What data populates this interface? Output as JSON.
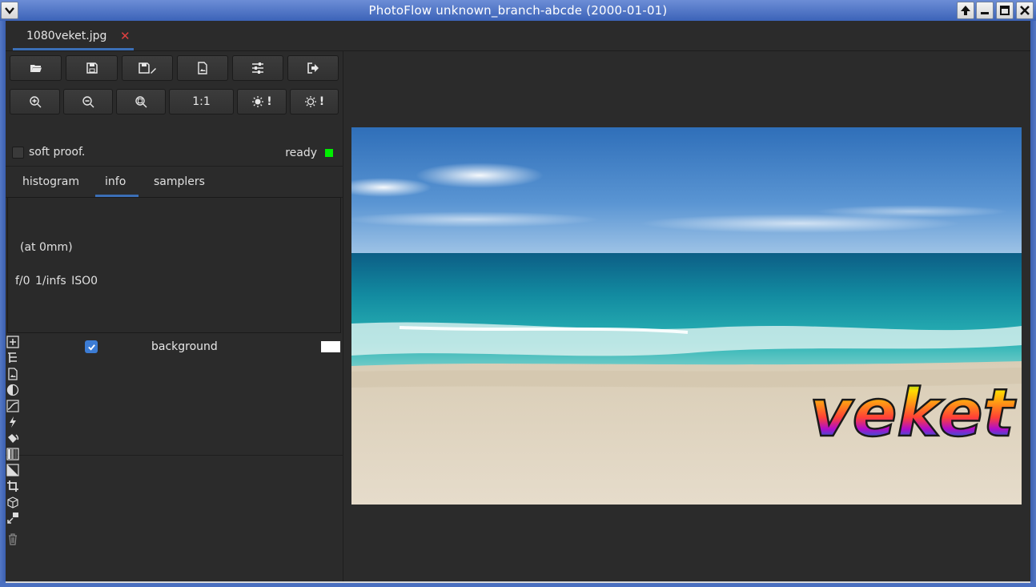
{
  "window": {
    "title": "PhotoFlow unknown_branch-abcde (2000-01-01)"
  },
  "document_tab": {
    "filename": "1080veket.jpg",
    "close_glyph": "✕"
  },
  "toolbar_row1": [
    {
      "name": "open-icon"
    },
    {
      "name": "save-icon"
    },
    {
      "name": "save-as-icon"
    },
    {
      "name": "export-image-icon"
    },
    {
      "name": "settings-sliders-icon"
    },
    {
      "name": "exit-icon"
    }
  ],
  "toolbar_row2": {
    "zoom_in": "zoom-in-icon",
    "zoom_out": "zoom-out-icon",
    "zoom_fit": "zoom-fit-icon",
    "zoom_100_label": "1:1",
    "highlights_warning": "!",
    "shadows_warning": "!"
  },
  "softproof": {
    "label": "soft proof."
  },
  "status": {
    "label": "ready",
    "color": "#00ee00"
  },
  "panel_tabs": [
    {
      "label": "histogram"
    },
    {
      "label": "info"
    },
    {
      "label": "samplers"
    }
  ],
  "active_panel_tab": "info",
  "info": {
    "lens_line": "(at 0mm)",
    "exposure_line": "f/0  1/infs  ISO0"
  },
  "layers": [
    {
      "name": "background",
      "visible": true,
      "swatch_color": "#ffffff"
    }
  ],
  "tools": [
    "add-layer-icon",
    "group-icon",
    "image-icon",
    "contrast-icon",
    "curves-icon",
    "lightning-icon",
    "paint-icon",
    "gradient-icon",
    "diagonal-icon",
    "crop-icon",
    "transform-icon",
    "clone-icon",
    "trash-icon"
  ],
  "photo": {
    "watermark_text": "veket"
  }
}
